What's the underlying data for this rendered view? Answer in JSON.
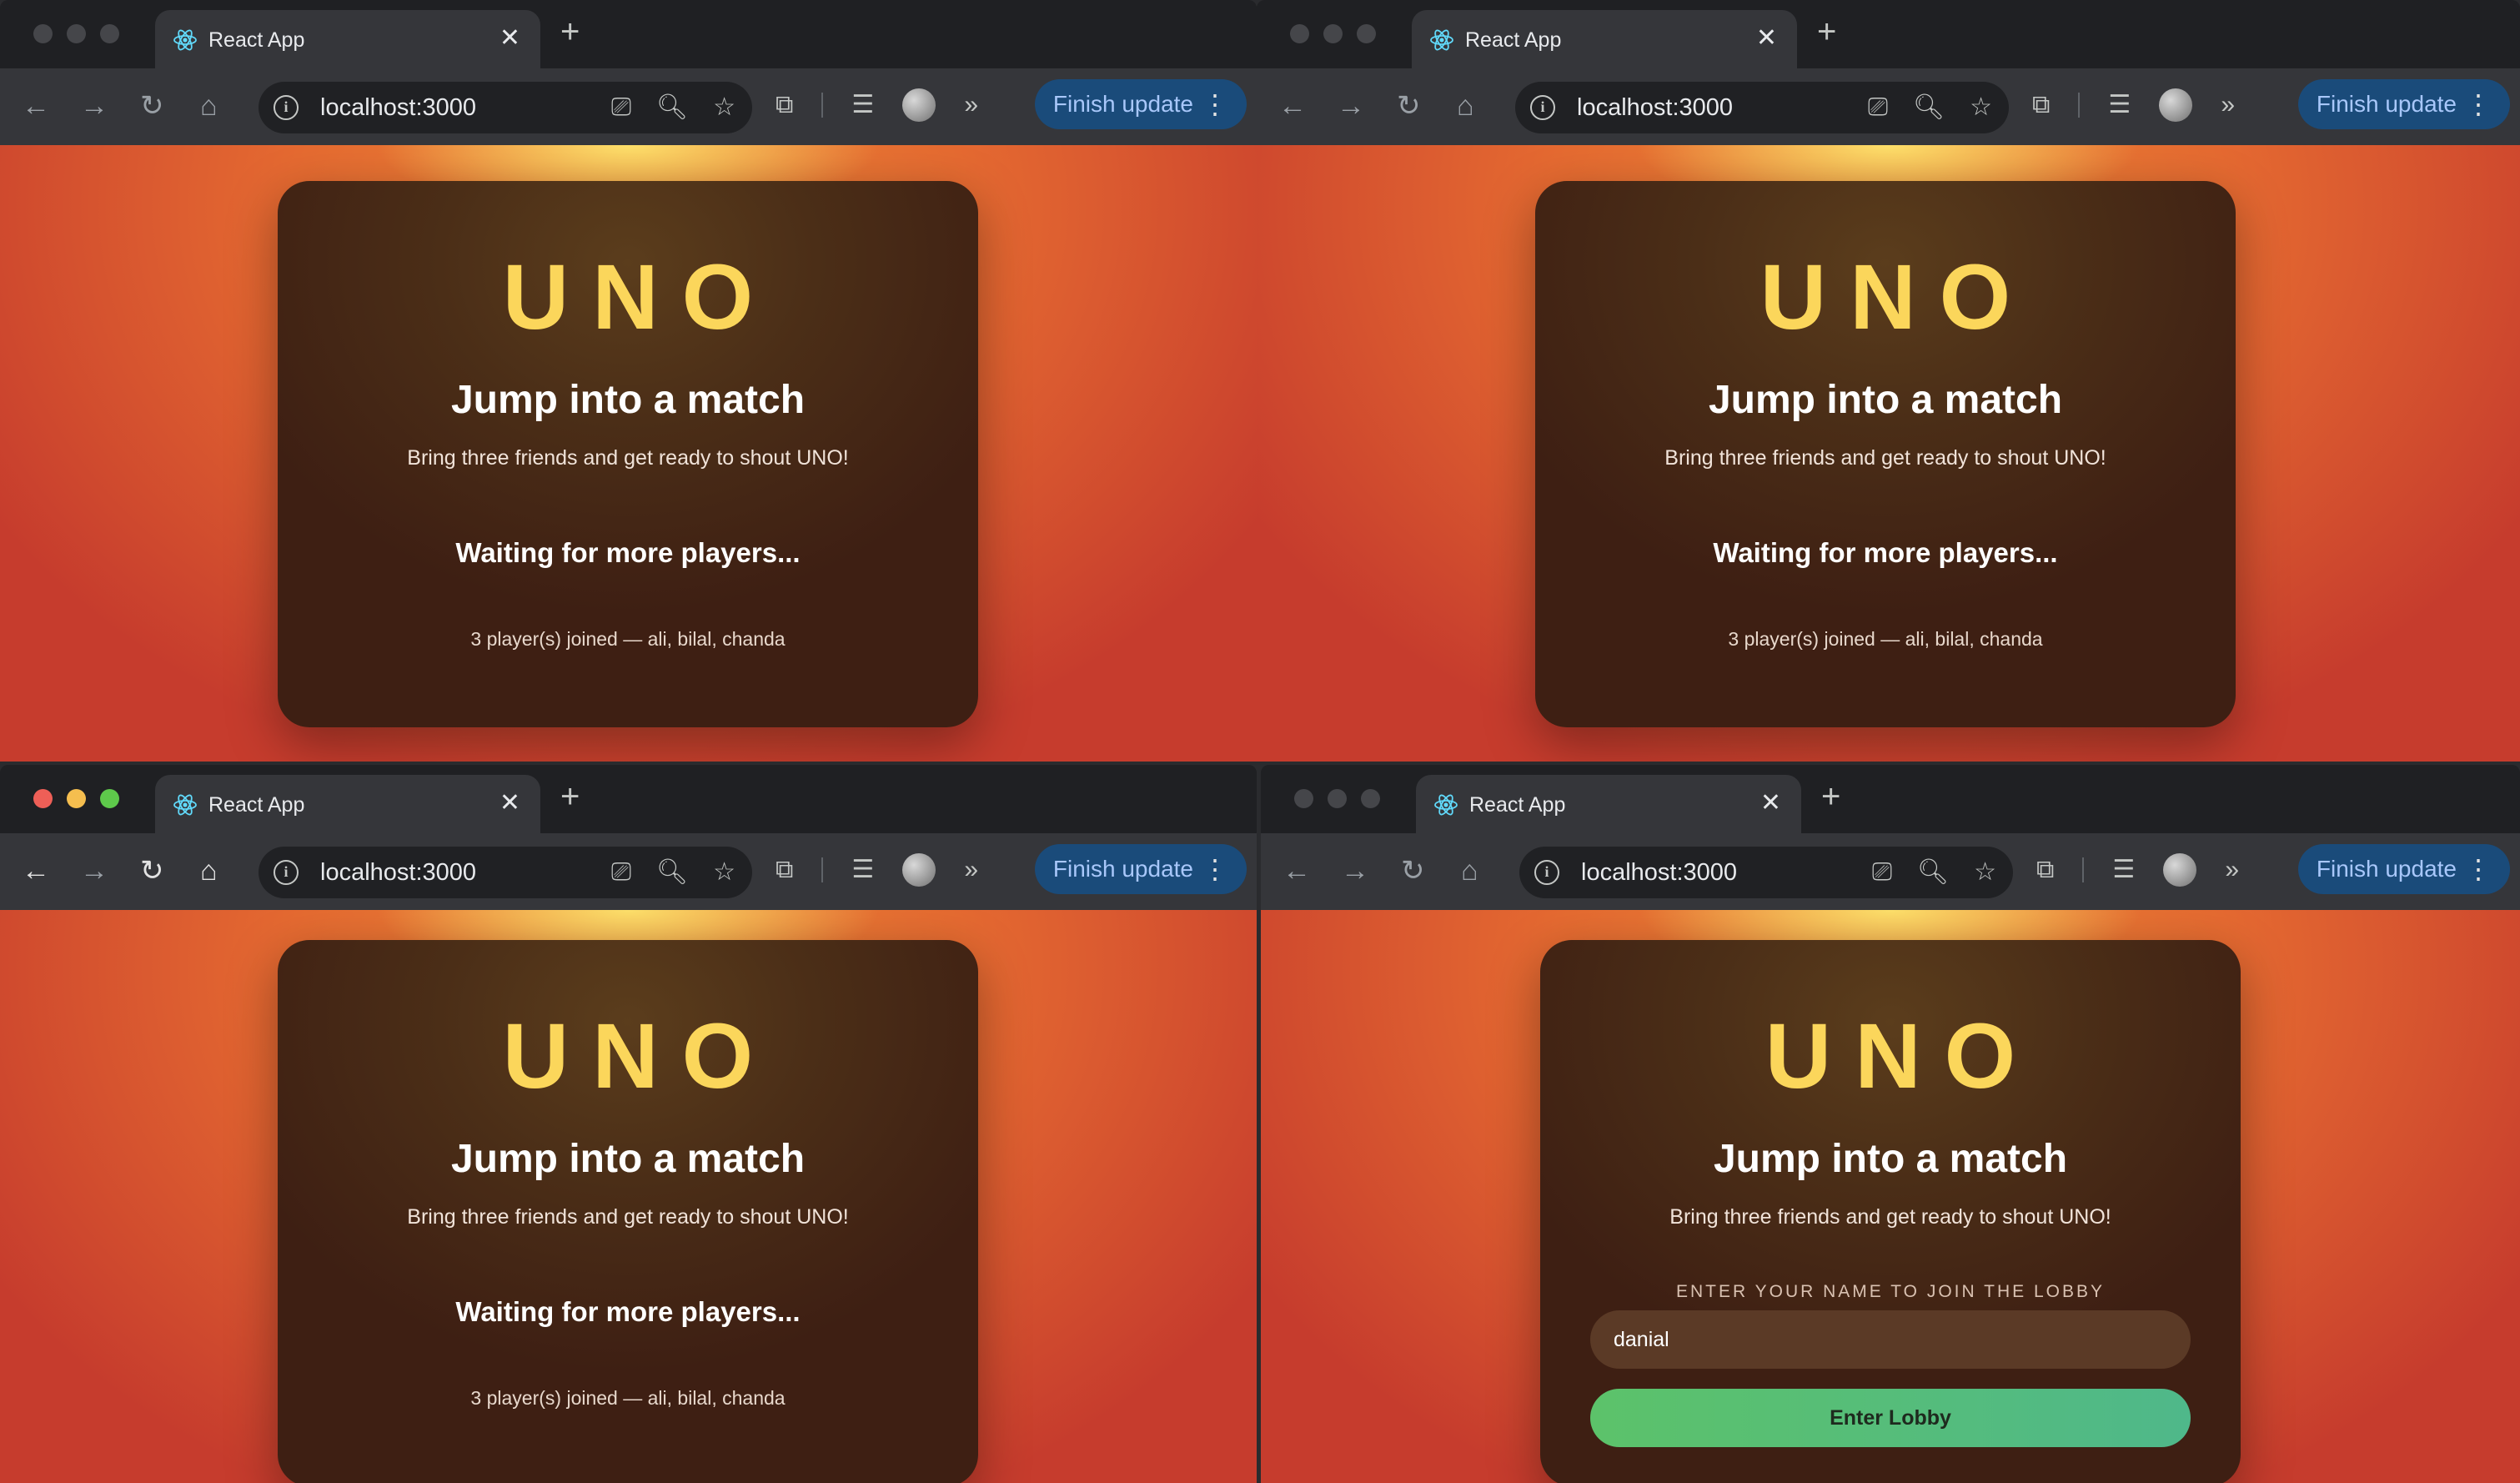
{
  "browser": {
    "tab_title": "React App",
    "close_glyph": "✕",
    "new_tab_glyph": "+",
    "url": "localhost:3000",
    "update_label": "Finish update",
    "menu_glyph": "⋮",
    "icons": {
      "back": "←",
      "forward": "→",
      "reload": "↻",
      "home": "⌂",
      "info": "i",
      "install": "⎚",
      "zoom": "🔍︎",
      "star": "☆",
      "extensions": "⧉",
      "media": "☰",
      "more": "»"
    }
  },
  "lobby": {
    "logo": "UNO",
    "heading": "Jump into a match",
    "subheading": "Bring three friends and get ready to shout UNO!",
    "waiting": "Waiting for more players...",
    "joined": "3 player(s) joined — ali, bilal, chanda"
  },
  "join_form": {
    "label": "ENTER YOUR NAME TO JOIN THE LOBBY",
    "name_value": "danial",
    "submit_label": "Enter Lobby"
  },
  "colors": {
    "accent_yellow": "#fbd65b",
    "button_green": "#5cc26a",
    "update_blue": "#1a4b7a"
  }
}
